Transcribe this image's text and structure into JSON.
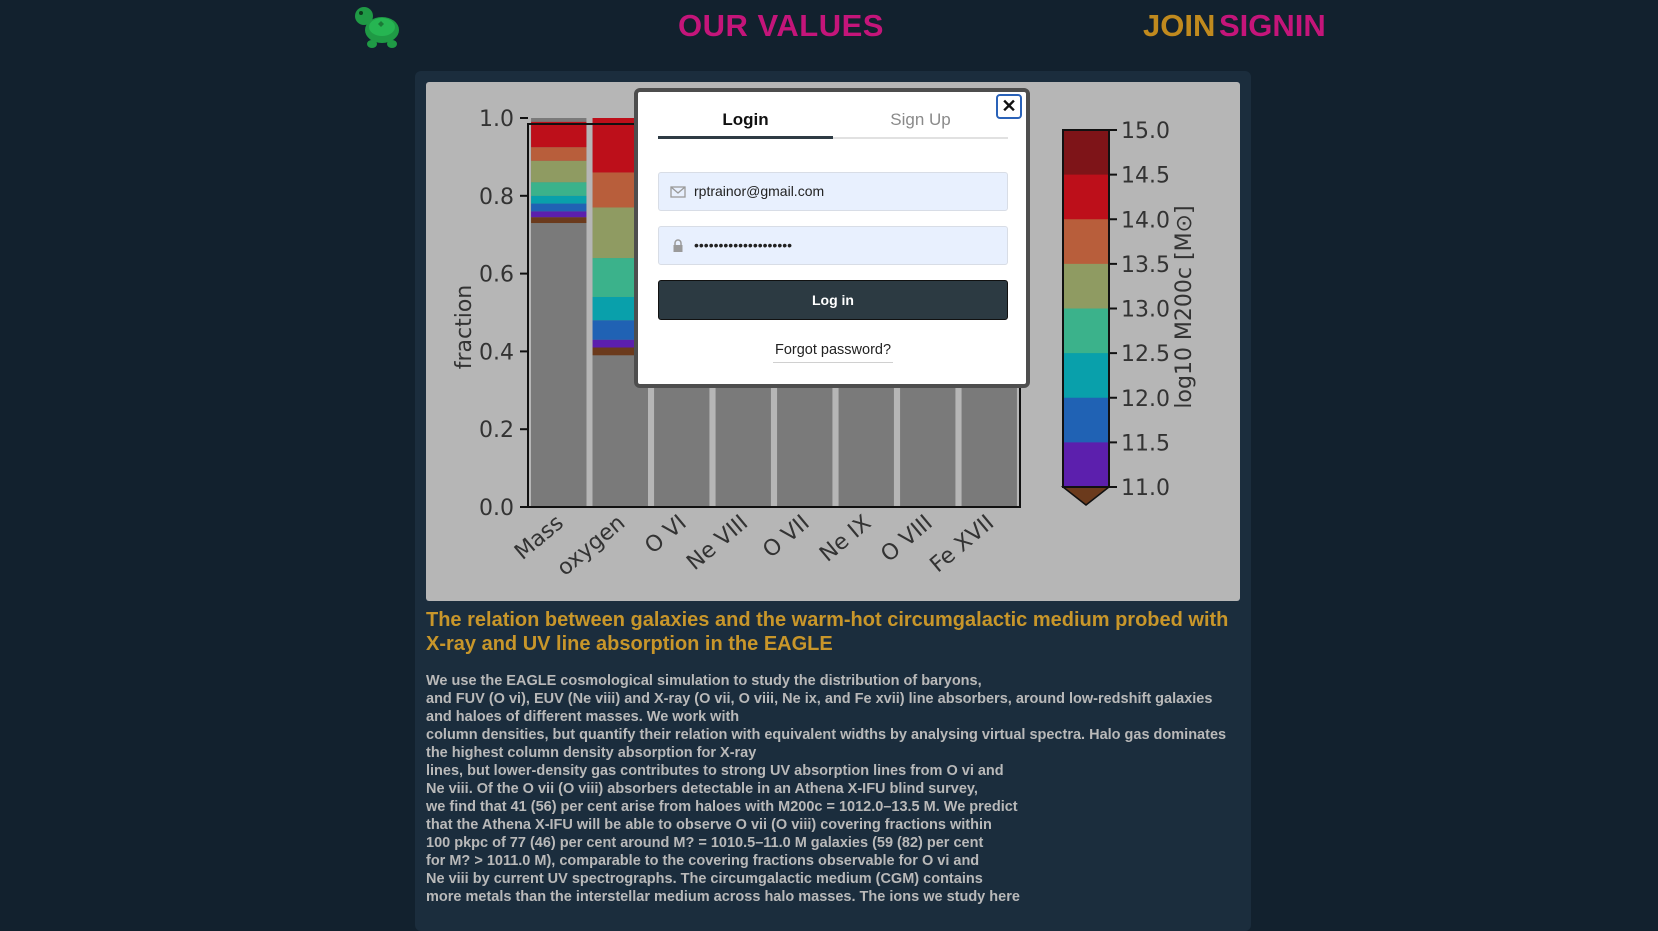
{
  "nav": {
    "values_label": "OUR VALUES",
    "join_label": "JOIN",
    "signin_label": "SIGNIN"
  },
  "colors": {
    "background": "#12212e",
    "card": "#1b2d3d",
    "magenta": "#c4157a",
    "gold": "#c08a1e",
    "logo_green": "#1f9a45"
  },
  "logo_icon": "turtle-icon",
  "figure": {
    "ylabel": "fraction",
    "yticks": [
      "0.0",
      "0.2",
      "0.4",
      "0.6",
      "0.8",
      "1.0"
    ],
    "categories": [
      "Mass",
      "oxygen",
      "O VI",
      "Ne VIII",
      "O VII",
      "Ne IX",
      "O VIII",
      "Fe XVII"
    ],
    "colorbar_ticks": [
      "15.0",
      "14.5",
      "14.0",
      "13.5",
      "13.0",
      "12.5",
      "12.0",
      "11.5",
      "11.0"
    ],
    "colorbar_label": "log10 M200c [M⊙]",
    "colorbar_colors": [
      "#7e1418",
      "#bd0f1a",
      "#b85e3b",
      "#8f9b62",
      "#3bb28b",
      "#09a0ab",
      "#2062b4",
      "#5c1fad"
    ],
    "colorbar_extend_color": "#6b3a1c"
  },
  "chart_data": {
    "type": "bar",
    "ylabel": "fraction",
    "ylim": [
      0,
      1.0
    ],
    "categories": [
      "Mass",
      "oxygen",
      "O VI",
      "Ne VIII",
      "O VII",
      "Ne IX",
      "O VIII",
      "Fe XVII"
    ],
    "stacks": [
      {
        "category": "Mass",
        "segments": [
          0.73,
          0.015,
          0.015,
          0.02,
          0.02,
          0.035,
          0.055,
          0.035,
          0.065
        ]
      },
      {
        "category": "oxygen",
        "segments": [
          0.39,
          0.02,
          0.02,
          0.05,
          0.06,
          0.1,
          0.13,
          0.09,
          0.14
        ]
      }
    ],
    "segment_colors": [
      "#7a7a7a",
      "#6b3a1c",
      "#5c1fad",
      "#2062b4",
      "#09a0ab",
      "#3bb28b",
      "#8f9b62",
      "#b85e3b",
      "#bd0f1a"
    ]
  },
  "paper": {
    "title": "The relation between galaxies and the warm-hot circumgalactic medium probed with X-ray and UV line absorption in the EAGLE",
    "abstract_lines": [
      "We use the EAGLE cosmological simulation to study the distribution of baryons,",
      "and FUV (O vi), EUV (Ne viii) and X-ray (O vii, O viii, Ne ix, and Fe xvii) line absorbers, around low-redshift galaxies and haloes of different masses. We work with",
      "column densities, but quantify their relation with equivalent widths by analysing virtual spectra. Halo gas dominates the highest column density absorption for X-ray",
      "lines, but lower-density gas contributes to strong UV absorption lines from O vi and",
      "Ne viii. Of the O vii (O viii) absorbers detectable in an Athena X-IFU blind survey,",
      "we find that 41 (56) per cent arise from haloes with M200c = 1012.0–13.5 M. We predict",
      "that the Athena X-IFU will be able to observe O vii (O viii) covering fractions within",
      "100 pkpc of 77 (46) per cent around M? = 1010.5–11.0 M galaxies (59 (82) per cent",
      "for M? > 1011.0 M), comparable to the covering fractions observable for O vi and",
      "Ne viii by current UV spectrographs. The circumgalactic medium (CGM) contains",
      "more metals than the interstellar medium across halo masses. The ions we study here"
    ]
  },
  "modal": {
    "tab_login": "Login",
    "tab_signup": "Sign Up",
    "close_label": "✕",
    "email_value": "rptrainor@gmail.com",
    "password_value": "••••••••••••••••••••",
    "login_button": "Log in",
    "forgot_link": "Forgot password?"
  }
}
